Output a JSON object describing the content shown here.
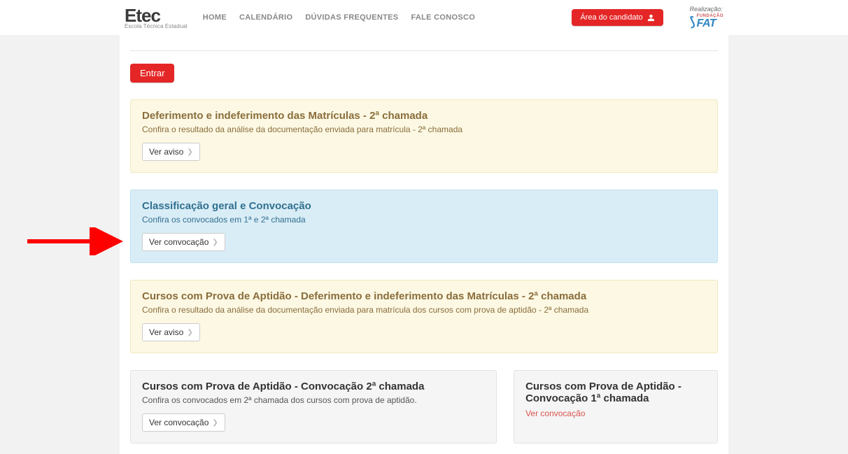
{
  "header": {
    "logo_main": "Etec",
    "logo_sub": "Escola Técnica Estadual",
    "nav": {
      "home": "HOME",
      "calendar": "CALENDÁRIO",
      "faq": "DÚVIDAS FREQUENTES",
      "contact": "FALE CONOSCO"
    },
    "area_btn": "Área do candidato",
    "realizacao_label": "Realização:",
    "fat_top": "FUNDAÇÃO",
    "fat_main": "FAT"
  },
  "enter_btn": "Entrar",
  "panel1": {
    "title": "Deferimento e indeferimento das Matrículas - 2ª chamada",
    "text": "Confira o resultado da análise da documentação enviada para matrícula - 2ª chamada",
    "button": "Ver aviso"
  },
  "panel2": {
    "title": "Classificação geral e Convocação",
    "text": "Confira os convocados em 1ª e 2ª chamada",
    "button": "Ver convocação"
  },
  "panel3": {
    "title": "Cursos com Prova de Aptidão - Deferimento e indeferimento das Matrículas - 2ª chamada",
    "text": "Confira o resultado da análise da documentação enviada para matrícula dos cursos com prova de aptidão - 2ª chamada",
    "button": "Ver aviso"
  },
  "panel4": {
    "title": "Cursos com Prova de Aptidão - Convocação 2ª chamada",
    "text": "Confira os convocados em 2ª chamada dos cursos com prova de aptidão.",
    "button": "Ver convocação"
  },
  "panel5": {
    "title": "Cursos com Prova de Aptidão - Convocação 1ª chamada",
    "link": "Ver convocação"
  }
}
